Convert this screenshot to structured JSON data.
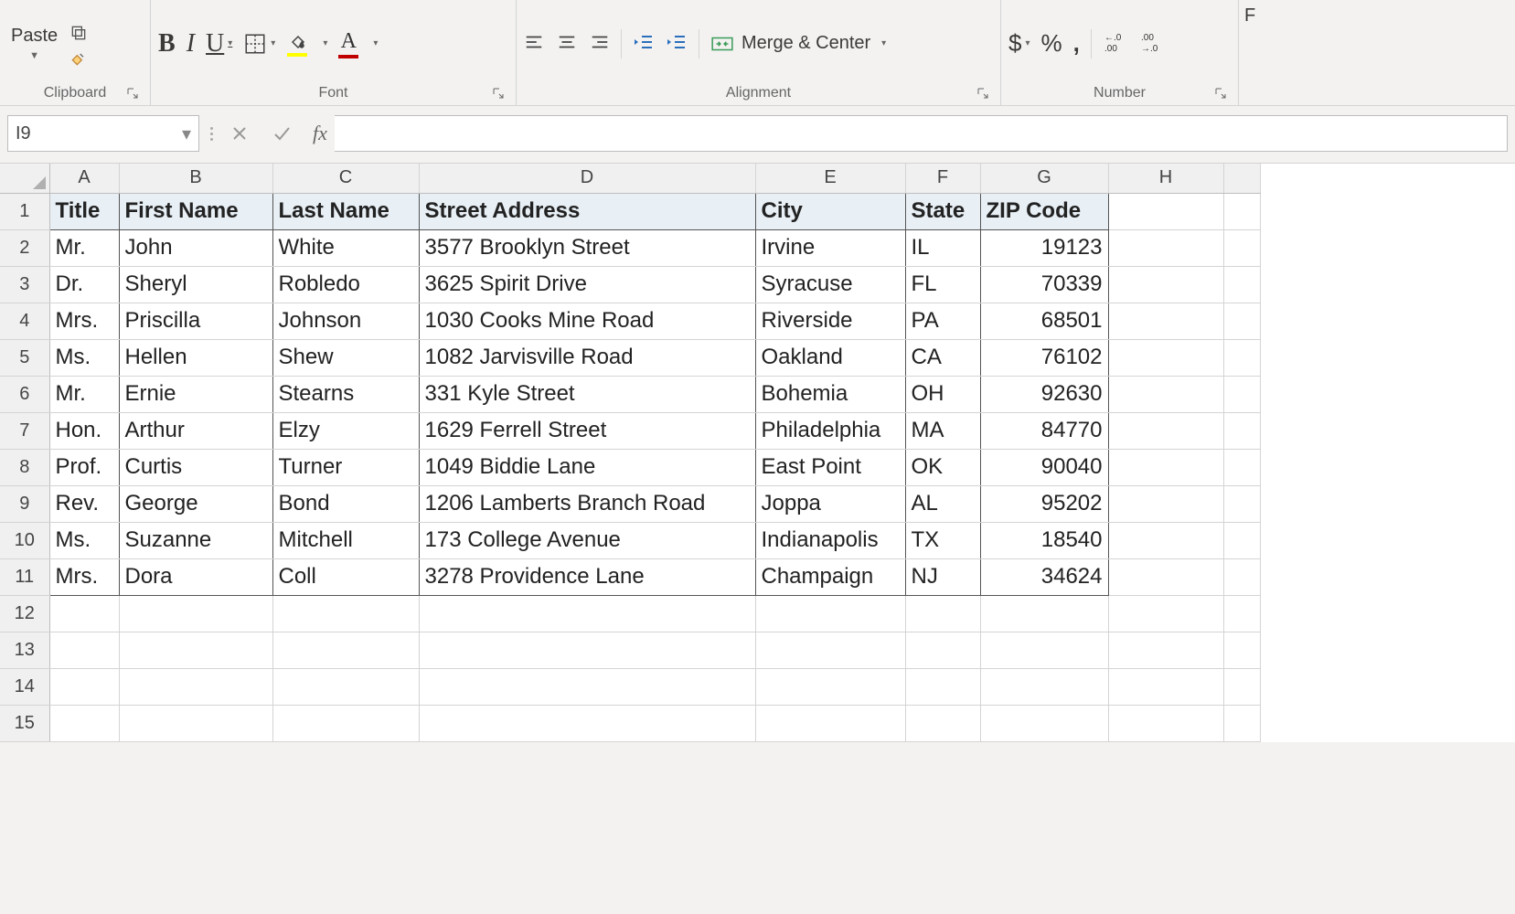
{
  "ribbon": {
    "clipboard": {
      "paste_label": "Paste",
      "group_label": "Clipboard"
    },
    "font": {
      "group_label": "Font",
      "bold": "B",
      "italic": "I",
      "underline": "U",
      "font_color": "#c00000",
      "fill_color": "#ffff00"
    },
    "alignment": {
      "group_label": "Alignment",
      "merge_label": "Merge & Center"
    },
    "number": {
      "group_label": "Number",
      "currency": "$",
      "percent": "%",
      "comma": ","
    },
    "partial": {
      "label_start": "F"
    }
  },
  "formula_bar": {
    "name_box": "I9",
    "fx_label": "fx",
    "formula": ""
  },
  "sheet": {
    "columns": [
      "A",
      "B",
      "C",
      "D",
      "E",
      "F",
      "G",
      "H"
    ],
    "row_count": 15,
    "headers": [
      "Title",
      "First Name",
      "Last Name",
      "Street Address",
      "City",
      "State",
      "ZIP Code"
    ],
    "rows": [
      {
        "title": "Mr.",
        "first": "John",
        "last": "White",
        "street": "3577 Brooklyn Street",
        "city": "Irvine",
        "state": "IL",
        "zip": "19123"
      },
      {
        "title": "Dr.",
        "first": "Sheryl",
        "last": "Robledo",
        "street": "3625 Spirit Drive",
        "city": "Syracuse",
        "state": "FL",
        "zip": "70339"
      },
      {
        "title": "Mrs.",
        "first": "Priscilla",
        "last": "Johnson",
        "street": "1030 Cooks Mine Road",
        "city": "Riverside",
        "state": "PA",
        "zip": "68501"
      },
      {
        "title": "Ms.",
        "first": "Hellen",
        "last": "Shew",
        "street": "1082 Jarvisville Road",
        "city": "Oakland",
        "state": "CA",
        "zip": "76102"
      },
      {
        "title": "Mr.",
        "first": "Ernie",
        "last": "Stearns",
        "street": "331 Kyle Street",
        "city": "Bohemia",
        "state": "OH",
        "zip": "92630"
      },
      {
        "title": "Hon.",
        "first": "Arthur",
        "last": "Elzy",
        "street": "1629 Ferrell Street",
        "city": "Philadelphia",
        "state": "MA",
        "zip": "84770"
      },
      {
        "title": "Prof.",
        "first": "Curtis",
        "last": "Turner",
        "street": "1049 Biddie Lane",
        "city": "East Point",
        "state": "OK",
        "zip": "90040"
      },
      {
        "title": "Rev.",
        "first": "George",
        "last": "Bond",
        "street": "1206 Lamberts Branch Road",
        "city": "Joppa",
        "state": "AL",
        "zip": "95202"
      },
      {
        "title": "Ms.",
        "first": "Suzanne",
        "last": "Mitchell",
        "street": "173 College Avenue",
        "city": "Indianapolis",
        "state": "TX",
        "zip": "18540"
      },
      {
        "title": "Mrs.",
        "first": "Dora",
        "last": "Coll",
        "street": "3278 Providence Lane",
        "city": "Champaign",
        "state": "NJ",
        "zip": "34624"
      }
    ]
  }
}
